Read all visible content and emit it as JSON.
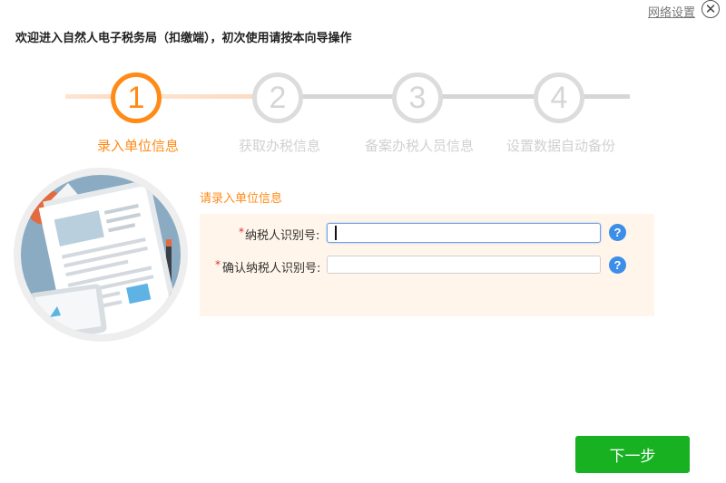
{
  "topbar": {
    "network_settings": "网络设置",
    "close_icon": "close-icon"
  },
  "welcome_text": "欢迎进入自然人电子税务局（扣缴端），初次使用请按本向导操作",
  "steps": [
    {
      "number": "1",
      "label": "录入单位信息",
      "active": true
    },
    {
      "number": "2",
      "label": "获取办税信息",
      "active": false
    },
    {
      "number": "3",
      "label": "备案办税人员信息",
      "active": false
    },
    {
      "number": "4",
      "label": "设置数据自动备份",
      "active": false
    }
  ],
  "form": {
    "section_title": "请录入单位信息",
    "taxpayer_id": {
      "required_mark": "*",
      "label": "纳税人识别号:",
      "value": ""
    },
    "confirm_taxpayer_id": {
      "required_mark": "*",
      "label": "确认纳税人识别号:",
      "value": ""
    },
    "help_glyph": "?"
  },
  "next_button": "下一步",
  "colors": {
    "accent": "#ff8a16",
    "primary_button": "#17b122",
    "help": "#3c8ee8",
    "form_bg": "#fff5ea"
  }
}
